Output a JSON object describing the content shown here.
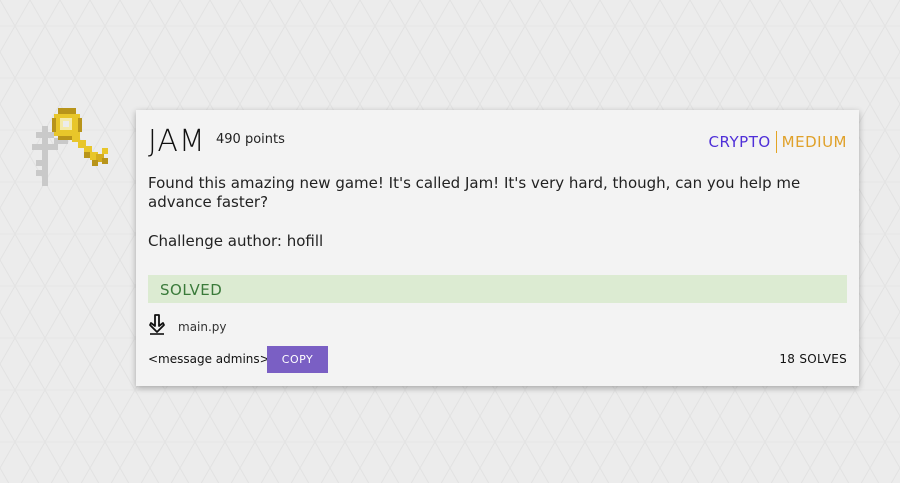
{
  "challenge": {
    "title": "JAM",
    "points": "490 points",
    "category": "CRYPTO",
    "difficulty": "MEDIUM",
    "description": "Found this amazing new game! It's called Jam! It's very hard, though, can you help me advance faster?",
    "author": "Challenge author: hofill",
    "status": "SOLVED",
    "file_name": "main.py",
    "file_icon": "download-icon",
    "message_admins": "<message admins>",
    "copy_label": "COPY",
    "solves": "18 SOLVES"
  },
  "icons": {
    "badge": "pixel-key-icon"
  },
  "colors": {
    "category": "#4f2fd8",
    "difficulty": "#e0a12a",
    "solved_bg": "#dcebd2",
    "solved_text": "#3a7a3a",
    "button": "#7a5fc4",
    "key_gold": "#e8c62a"
  }
}
